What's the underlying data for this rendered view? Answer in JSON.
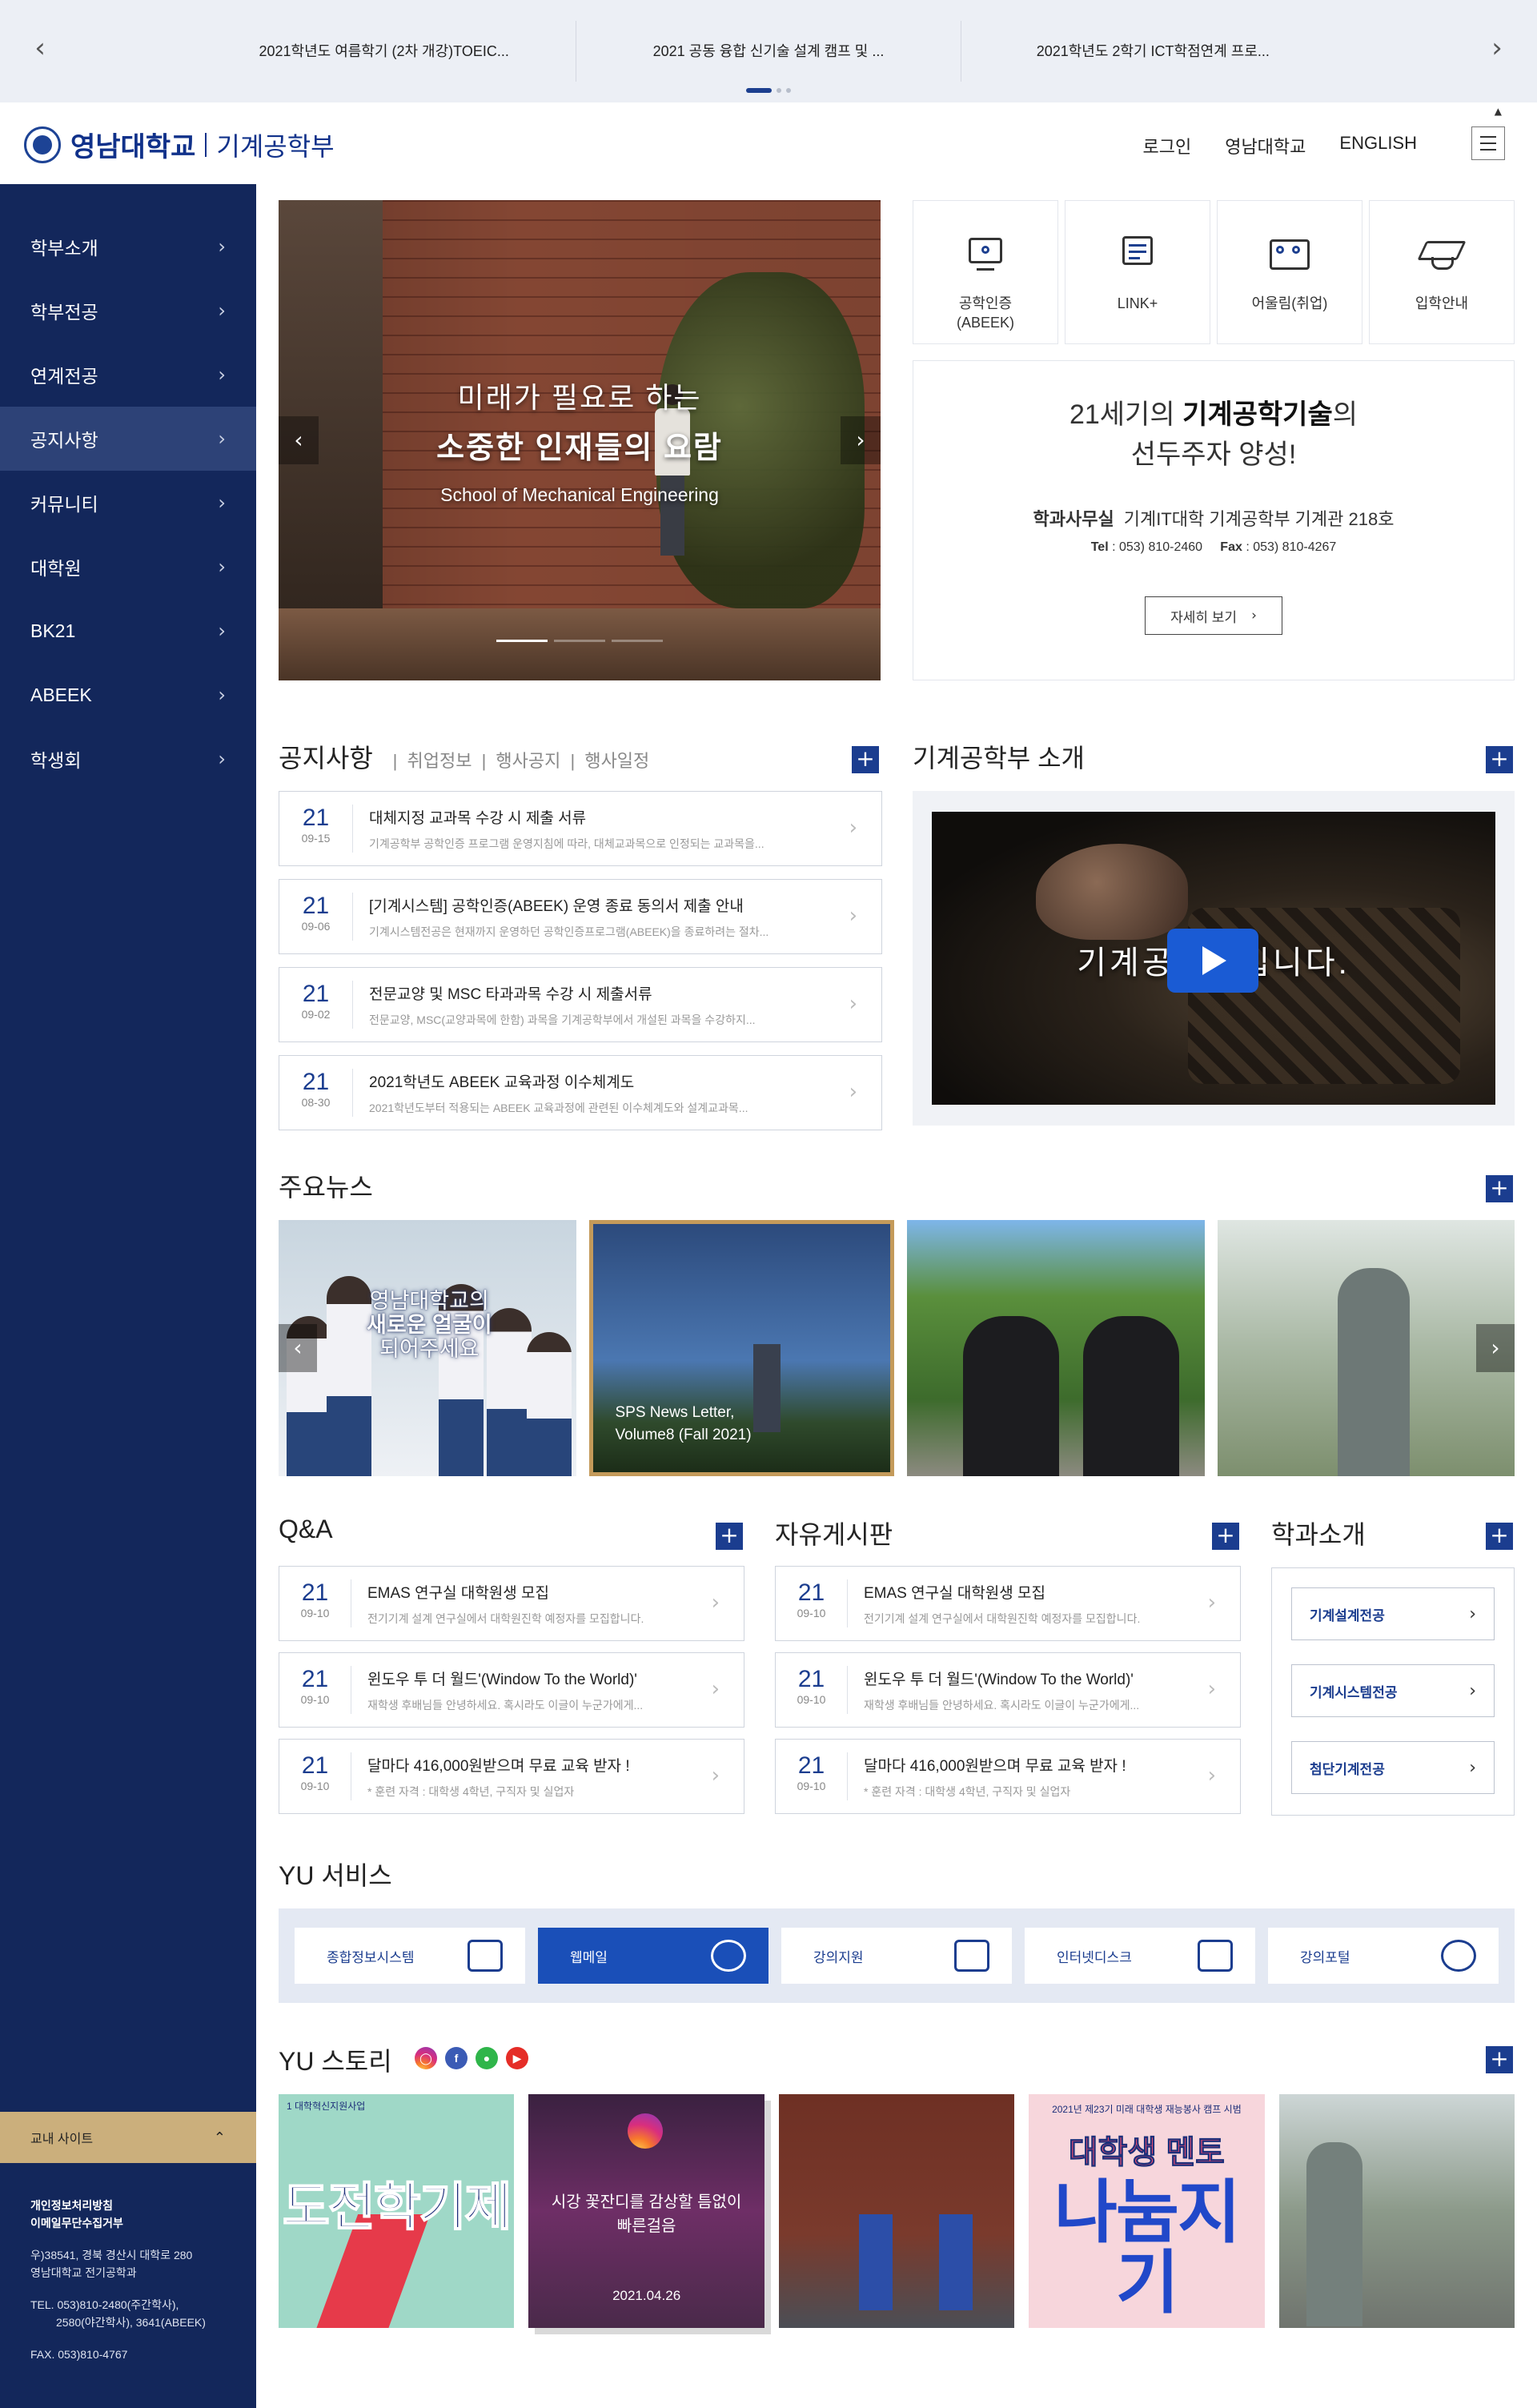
{
  "ticker": {
    "items": [
      "2021학년도 여름학기 (2차 개강)TOEIC...",
      "2021 공동 융합 신기술 설계 캠프 및 ...",
      "2021학년도 2학기 ICT학점연계 프로..."
    ]
  },
  "header": {
    "university": "영남대학교",
    "department": "기계공학부",
    "nav": [
      "로그인",
      "영남대학교",
      "ENGLISH"
    ]
  },
  "sidebar": {
    "items": [
      {
        "label": "학부소개"
      },
      {
        "label": "학부전공"
      },
      {
        "label": "연계전공"
      },
      {
        "label": "공지사항"
      },
      {
        "label": "커뮤니티"
      },
      {
        "label": "대학원"
      },
      {
        "label": "BK21"
      },
      {
        "label": "ABEEK"
      },
      {
        "label": "학생회"
      }
    ],
    "active_index": 3,
    "campus_sites": "교내 사이트",
    "footer": {
      "privacy": "개인정보처리방침",
      "email_refusal": "이메일무단수집거부",
      "address1": "우)38541, 경북 경산시 대학로 280",
      "address2": "영남대학교 전기공학과",
      "tel1": "TEL. 053)810-2480(주간학사),",
      "tel2": "2580(야간학사), 3641(ABEEK)",
      "fax": "FAX. 053)810-4767"
    }
  },
  "hero": {
    "line1": "미래가 필요로 하는",
    "line2": "소중한 인재들의 요람",
    "line3": "School of Mechanical Engineering"
  },
  "quick_links": [
    {
      "label": "공학인증\n(ABEEK)",
      "icon": "certified-monitor-icon"
    },
    {
      "label": "LINK+",
      "icon": "link-board-icon"
    },
    {
      "label": "어울림(취업)",
      "icon": "people-card-icon"
    },
    {
      "label": "입학안내",
      "icon": "graduation-cap-icon"
    }
  ],
  "intro": {
    "line1_pre": "21세기의 ",
    "line1_bold": "기계공학기술",
    "line1_post": "의",
    "line2": "선두주자 양성!",
    "office_label": "학과사무실",
    "office_value": "기계IT대학 기계공학부 기계관 218호",
    "tel_label": "Tel",
    "tel_value": " : 053) 810-2460",
    "fax_label": "Fax",
    "fax_value": " : 053) 810-4267",
    "more": "자세히 보기"
  },
  "notice": {
    "title": "공지사항",
    "tabs": [
      "취업정보",
      "행사공지",
      "행사일정"
    ],
    "items": [
      {
        "day": "21",
        "date": "09-15",
        "title": "대체지정 교과목 수강 시 제출 서류",
        "summary": "기계공학부 공학인증 프로그램 운영지침에 따라, 대체교과목으로 인정되는 교과목을..."
      },
      {
        "day": "21",
        "date": "09-06",
        "title": "[기계시스템] 공학인증(ABEEK) 운영 종료 동의서 제출 안내",
        "summary": "기계시스템전공은 현재까지 운영하던 공학인증프로그램(ABEEK)을 종료하려는 절차..."
      },
      {
        "day": "21",
        "date": "09-02",
        "title": "전문교양 및 MSC 타과과목 수강 시 제출서류",
        "summary": "전문교양, MSC(교양과목에 한함) 과목을 기계공학부에서 개설된 과목을 수강하지..."
      },
      {
        "day": "21",
        "date": "08-30",
        "title": "2021학년도 ABEEK 교육과정 이수체계도",
        "summary": "2021학년도부터 적용되는 ABEEK 교육과정에 관련된 이수체계도와 설계교과목..."
      }
    ]
  },
  "intro_video": {
    "title": "기계공학부 소개",
    "caption": "기계공학부입니다."
  },
  "news": {
    "title": "주요뉴스",
    "card1_a": "영남대학교의",
    "card1_b": "새로운 얼굴이",
    "card1_c": "되어주세요",
    "card2_a": "SPS News Letter,",
    "card2_b": "Volume8 (Fall 2021)"
  },
  "qa": {
    "title": "Q&A",
    "items": [
      {
        "day": "21",
        "date": "09-10",
        "title": "EMAS 연구실 대학원생 모집",
        "summary": "전기기계 설계 연구실에서 대학원진학 예정자를 모집합니다."
      },
      {
        "day": "21",
        "date": "09-10",
        "title": "윈도우 투 더 월드'(Window To the World)'",
        "summary": "재학생 후배님들 안녕하세요. 혹시라도 이글이 누군가에게..."
      },
      {
        "day": "21",
        "date": "09-10",
        "title": "달마다 416,000원받으며 무료 교육 받자 !",
        "summary": "* 훈련 자격 : 대학생 4학년, 구직자 및 실업자"
      }
    ]
  },
  "free_board": {
    "title": "자유게시판",
    "items": [
      {
        "day": "21",
        "date": "09-10",
        "title": "EMAS 연구실 대학원생 모집",
        "summary": "전기기계 설계 연구실에서 대학원진학 예정자를 모집합니다."
      },
      {
        "day": "21",
        "date": "09-10",
        "title": "윈도우 투 더 월드'(Window To the World)'",
        "summary": "재학생 후배님들 안녕하세요. 혹시라도 이글이 누군가에게..."
      },
      {
        "day": "21",
        "date": "09-10",
        "title": "달마다 416,000원받으며 무료 교육 받자 !",
        "summary": "* 훈련 자격 : 대학생 4학년, 구직자 및 실업자"
      }
    ]
  },
  "dept_intro": {
    "title": "학과소개",
    "items": [
      "기계설계전공",
      "기계시스템전공",
      "첨단기계전공"
    ]
  },
  "yu_service": {
    "title": "YU 서비스",
    "items": [
      "종합정보시스템",
      "웹메일",
      "강의지원",
      "인터넷디스크",
      "강의포털"
    ],
    "active_index": 1
  },
  "yu_story": {
    "title": "YU 스토리",
    "sns": [
      "instagram-icon",
      "facebook-icon",
      "kakao-icon",
      "youtube-icon"
    ],
    "card1_header": "1 대학혁신지원사업",
    "card1_title": "도전학기제",
    "card2_text1": "시강 꽃잔디를 감상할 틈없이",
    "card2_text2": "빠른걸음",
    "card2_date": "2021.04.26",
    "card4_top": "2021년 제23기 미래 대학생 재능봉사 캠프 시범",
    "card4_t1": "대학생 멘토",
    "card4_t2": "나눔지기"
  },
  "colors": {
    "navy": "#13275b",
    "accent": "#1b3d8f",
    "active_service": "#1a4fb8",
    "campus_gold": "#cbaf7c"
  }
}
